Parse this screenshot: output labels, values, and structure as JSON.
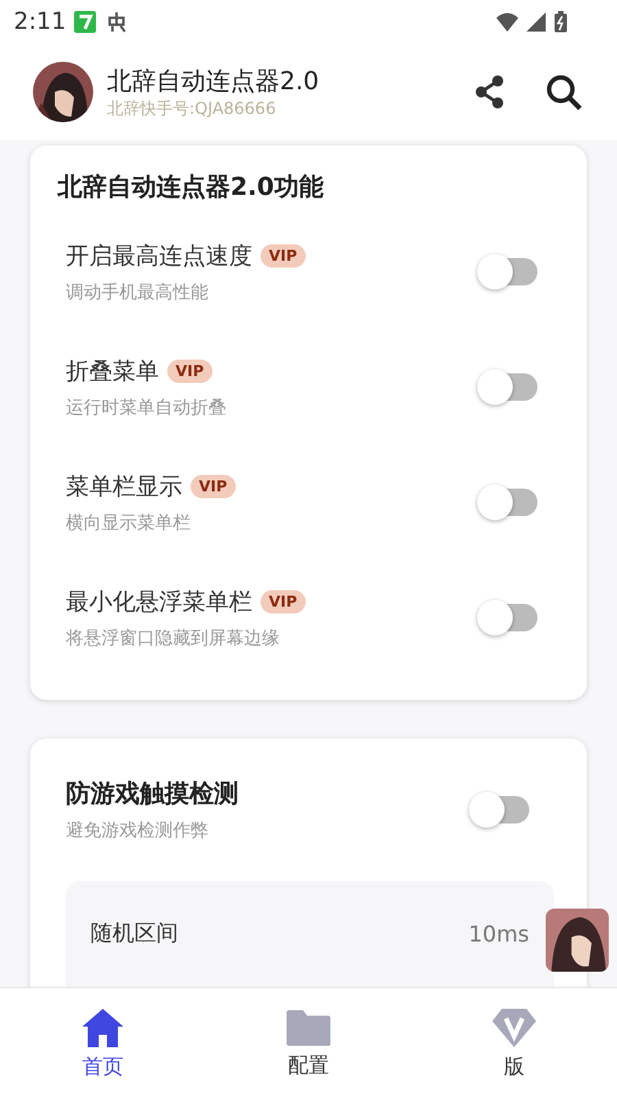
{
  "status_bar": {
    "time": "2:11"
  },
  "header": {
    "title": "北辞自动连点器2.0",
    "subtitle": "北辞快手号:QJA86666"
  },
  "feature_card": {
    "title": "北辞自动连点器2.0功能",
    "items": [
      {
        "label": "开启最高连点速度",
        "badge": "VIP",
        "description": "调动手机最高性能",
        "on": false
      },
      {
        "label": "折叠菜单",
        "badge": "VIP",
        "description": "运行时菜单自动折叠",
        "on": false
      },
      {
        "label": "菜单栏显示",
        "badge": "VIP",
        "description": "横向显示菜单栏",
        "on": false
      },
      {
        "label": "最小化悬浮菜单栏",
        "badge": "VIP",
        "description": "将悬浮窗口隐藏到屏幕边缘",
        "on": false
      }
    ]
  },
  "detect_card": {
    "title": "防游戏触摸检测",
    "description": "避免游戏检测作弊",
    "on": false,
    "rows": [
      {
        "label": "随机区间",
        "value": "10ms"
      }
    ]
  },
  "nav": [
    {
      "kind": "home",
      "label": "首页",
      "selected": true
    },
    {
      "kind": "folder",
      "label": "配置",
      "selected": false
    },
    {
      "kind": "vip",
      "label": "版",
      "selected": false
    }
  ]
}
